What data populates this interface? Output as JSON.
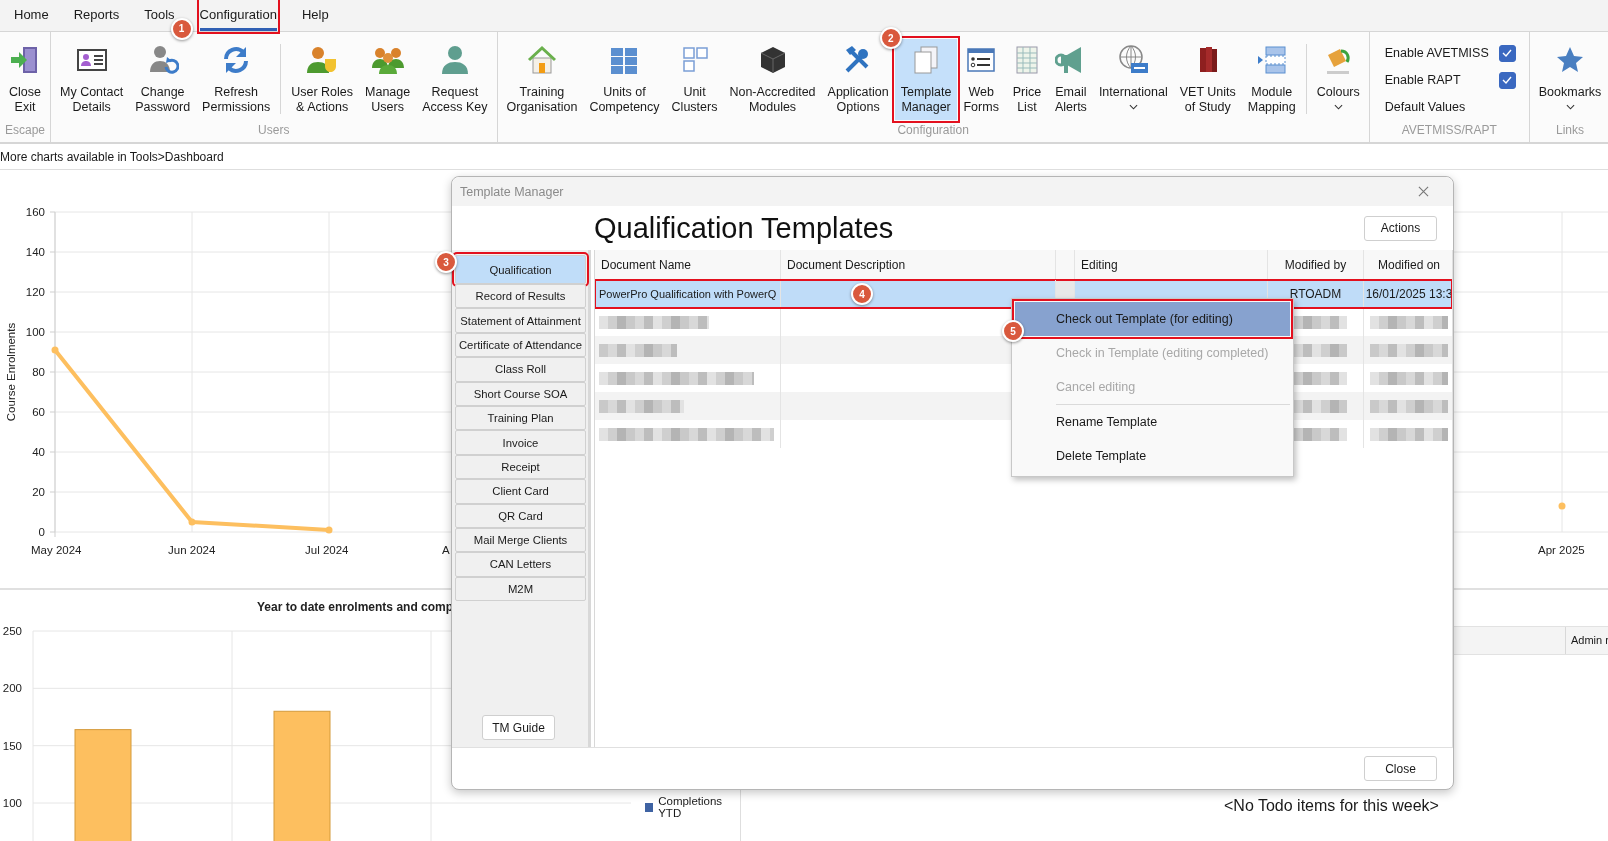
{
  "menu_tabs": [
    {
      "label": "Home",
      "selected": false
    },
    {
      "label": "Reports",
      "selected": false
    },
    {
      "label": "Tools",
      "selected": false
    },
    {
      "label": "Configuration",
      "selected": true,
      "callout": "1"
    },
    {
      "label": "Help",
      "selected": false
    }
  ],
  "ribbon": {
    "groups": [
      {
        "label": "Escape",
        "items": [
          {
            "kind": "exit",
            "lines": [
              "Close",
              "Exit"
            ],
            "selected": false,
            "dropdown": false
          }
        ]
      },
      {
        "label": "Users",
        "items": [
          {
            "kind": "contact",
            "lines": [
              "My Contact",
              "Details"
            ],
            "selected": false,
            "dropdown": false
          },
          {
            "kind": "password",
            "lines": [
              "Change",
              "Password"
            ],
            "selected": false,
            "dropdown": false
          },
          {
            "kind": "refresh",
            "lines": [
              "Refresh",
              "Permissions"
            ],
            "selected": false,
            "dropdown": false
          },
          {
            "kind": "separator"
          },
          {
            "kind": "roles",
            "lines": [
              "User Roles",
              "& Actions"
            ],
            "selected": false,
            "dropdown": false
          },
          {
            "kind": "users",
            "lines": [
              "Manage",
              "Users"
            ],
            "selected": false,
            "dropdown": false
          },
          {
            "kind": "person",
            "lines": [
              "Request",
              "Access Key"
            ],
            "selected": false,
            "dropdown": false
          }
        ]
      },
      {
        "label": "Configuration",
        "items": [
          {
            "kind": "house",
            "lines": [
              "Training",
              "Organisation"
            ],
            "selected": false,
            "dropdown": false
          },
          {
            "kind": "grid",
            "lines": [
              "Units of",
              "Competency"
            ],
            "selected": false,
            "dropdown": false
          },
          {
            "kind": "squares",
            "lines": [
              "Unit",
              "Clusters"
            ],
            "selected": false,
            "dropdown": false
          },
          {
            "kind": "cube",
            "lines": [
              "Non-Accredited",
              "Modules"
            ],
            "selected": false,
            "dropdown": false
          },
          {
            "kind": "tools",
            "lines": [
              "Application",
              "Options"
            ],
            "selected": false,
            "dropdown": false
          },
          {
            "kind": "documents",
            "lines": [
              "Template",
              "Manager"
            ],
            "selected": true,
            "dropdown": false,
            "callout": "2"
          },
          {
            "kind": "form",
            "lines": [
              "Web",
              "Forms"
            ],
            "selected": false,
            "dropdown": false
          },
          {
            "kind": "sheet",
            "lines": [
              "Price",
              "List"
            ],
            "selected": false,
            "dropdown": false
          },
          {
            "kind": "megaphone",
            "lines": [
              "Email",
              "Alerts"
            ],
            "selected": false,
            "dropdown": false
          },
          {
            "kind": "globe",
            "lines": [
              "International"
            ],
            "selected": false,
            "dropdown": true
          },
          {
            "kind": "books",
            "lines": [
              "VET Units",
              "of Study"
            ],
            "selected": false,
            "dropdown": false
          },
          {
            "kind": "mapping",
            "lines": [
              "Module",
              "Mapping"
            ],
            "selected": false,
            "dropdown": false
          },
          {
            "kind": "separator"
          },
          {
            "kind": "bucket",
            "lines": [
              "Colours"
            ],
            "selected": false,
            "dropdown": true
          }
        ]
      },
      {
        "label": "AVETMISS/RAPT",
        "options": [
          {
            "kind": "checkbox",
            "label": "Enable AVETMISS",
            "checked": true
          },
          {
            "kind": "checkbox",
            "label": "Enable RAPT",
            "checked": true
          },
          {
            "kind": "command",
            "label": "Default Values"
          }
        ]
      },
      {
        "label": "Links",
        "items": [
          {
            "kind": "star",
            "lines": [
              "Bookmarks"
            ],
            "selected": false,
            "dropdown": true
          }
        ]
      }
    ]
  },
  "info_text": "More charts available in Tools>Dashboard",
  "line_chart": {
    "chart_data": {
      "type": "line",
      "ylabel": "Course Enrolments",
      "grid": true,
      "categories": [
        "May 2024",
        "Jun 2024",
        "Jul 2024",
        "A",
        null,
        null,
        null,
        null,
        null,
        null,
        null,
        "Apr 2025",
        null
      ],
      "ylim": [
        0,
        160
      ],
      "yticks": [
        0,
        20,
        40,
        60,
        80,
        100,
        120,
        140,
        160
      ],
      "series": [
        {
          "color": "#fdbf5f",
          "marker": true,
          "values": [
            91,
            5,
            1,
            null,
            null,
            null,
            null,
            null,
            null,
            null,
            null,
            13,
            null
          ]
        }
      ]
    }
  },
  "bar_chart": {
    "chart_data": {
      "type": "bar",
      "title": "Year to date enrolments and comp",
      "grid": true,
      "ylim": [
        0,
        250
      ],
      "yticks": [
        100,
        150,
        200,
        250
      ],
      "series": [
        {
          "color": "#fdbf5f",
          "values": [
            164,
            180,
            null
          ]
        }
      ]
    },
    "legend": [
      {
        "label": "Completions YTD",
        "color": "#3f63a3"
      }
    ]
  },
  "todo": {
    "columns": [
      "Admin r"
    ],
    "empty_text": "<No Todo items for this week>"
  },
  "dialog": {
    "title": "Template Manager",
    "heading": "Qualification Templates",
    "actions_button": "Actions",
    "categories": [
      {
        "label": "Qualification",
        "selected": true,
        "callout": "3"
      },
      {
        "label": "Record of Results",
        "selected": false
      },
      {
        "label": "Statement of Attainment",
        "selected": false
      },
      {
        "label": "Certificate of Attendance",
        "selected": false
      },
      {
        "label": "Class Roll",
        "selected": false
      },
      {
        "label": "Short Course SOA",
        "selected": false
      },
      {
        "label": "Training Plan",
        "selected": false
      },
      {
        "label": "Invoice",
        "selected": false
      },
      {
        "label": "Receipt",
        "selected": false
      },
      {
        "label": "Client Card",
        "selected": false
      },
      {
        "label": "QR Card",
        "selected": false
      },
      {
        "label": "Mail Merge Clients",
        "selected": false
      },
      {
        "label": "CAN Letters",
        "selected": false
      },
      {
        "label": "M2M",
        "selected": false
      }
    ],
    "guide_button": "TM Guide",
    "table": {
      "columns": [
        "Document Name",
        "Document Description",
        "Editing",
        "Modified by",
        "Modified on"
      ],
      "rows": [
        {
          "kind": "document",
          "name": "PowerPro Qualification with PowerQ",
          "modified_by": "RTOADM",
          "modified_on": "16/01/2025 13:3",
          "selected": true,
          "callout": "4"
        },
        {
          "kind": "redacted",
          "selected": false
        },
        {
          "kind": "redacted",
          "selected": false
        },
        {
          "kind": "redacted",
          "selected": false
        },
        {
          "kind": "redacted",
          "selected": false
        },
        {
          "kind": "redacted",
          "selected": false
        }
      ]
    },
    "context_menu": [
      {
        "kind": "command",
        "label": "Check out Template (for editing)",
        "selected": true,
        "disabled": false,
        "callout": "5"
      },
      {
        "kind": "command",
        "label": "Check in Template (editing completed)",
        "selected": false,
        "disabled": true
      },
      {
        "kind": "command",
        "label": "Cancel editing",
        "selected": false,
        "disabled": true
      },
      {
        "kind": "separator"
      },
      {
        "kind": "command",
        "label": "Rename Template",
        "selected": false,
        "disabled": false
      },
      {
        "kind": "command",
        "label": "Delete Template",
        "selected": false,
        "disabled": false
      }
    ],
    "close_button": "Close"
  }
}
